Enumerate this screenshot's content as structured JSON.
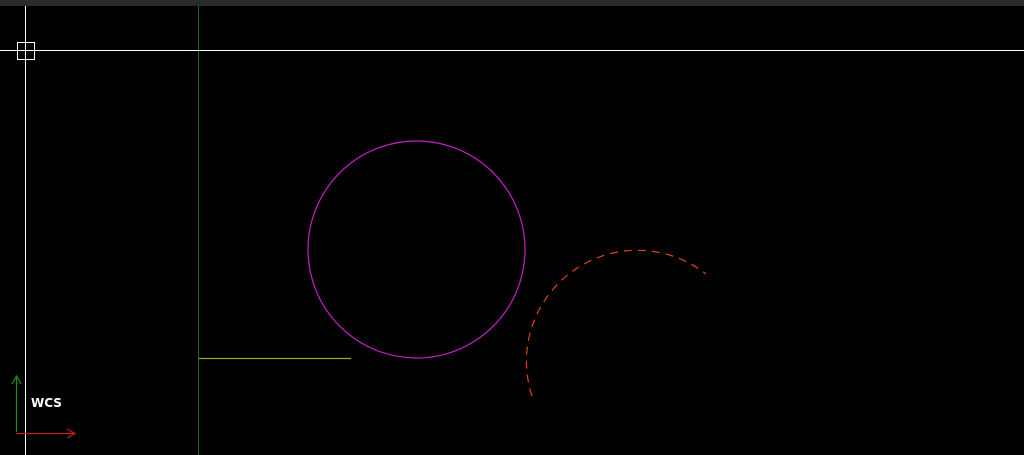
{
  "window": {
    "viewport": "model-space"
  },
  "colors": {
    "background": "#000000",
    "top_strip": "#2b2b2b",
    "crosshair": "#ffffff",
    "guide_line": "#1f6b1f",
    "circle": "#c81ec8",
    "dashed_arc": "#e0431a",
    "line": "#9ea81a",
    "ucs_x_axis": "#c81e1e",
    "ucs_y_axis": "#1e8c1e"
  },
  "icons": {
    "cursor": "crosshair-pickbox-icon",
    "ucs": "ucs-axis-icon"
  },
  "ucs": {
    "label": "WCS"
  },
  "entities": [
    {
      "kind": "circle",
      "name": "magenta-circle"
    },
    {
      "kind": "arc",
      "linetype": "dashed",
      "name": "orange-dashed-arc"
    },
    {
      "kind": "line",
      "name": "yellow-line"
    },
    {
      "kind": "xline",
      "name": "green-construction-line"
    }
  ]
}
